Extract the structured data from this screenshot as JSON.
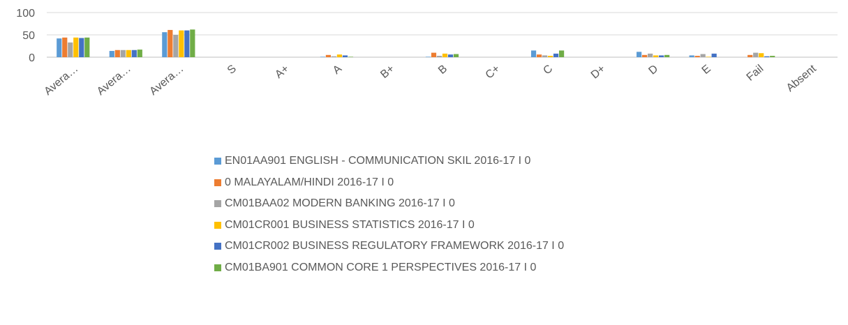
{
  "chart_data": {
    "type": "bar",
    "categories": [
      "Avera…",
      "Avera…",
      "Avera…",
      "S",
      "A+",
      "A",
      "B+",
      "B",
      "C+",
      "C",
      "D+",
      "D",
      "E",
      "Fail",
      "Absent"
    ],
    "ylim": [
      0,
      100
    ],
    "yticks": [
      0,
      50,
      100
    ],
    "grid": true,
    "legend_position": "bottom",
    "series": [
      {
        "name": "EN01AA901 ENGLISH - COMMUNICATION SKIL 2016-17 I 0",
        "color": "#5B9BD5",
        "values": [
          42,
          14,
          56,
          0,
          0,
          1,
          0,
          1,
          0,
          15,
          0,
          12,
          4,
          0,
          0
        ]
      },
      {
        "name": "0 MALAYALAM/HINDI 2016-17 I 0",
        "color": "#ED7D31",
        "values": [
          44,
          16,
          61,
          0,
          0,
          5,
          0,
          10,
          0,
          6,
          0,
          5,
          3,
          5,
          0
        ]
      },
      {
        "name": "CM01BAA02 MODERN BANKING 2016-17 I 0",
        "color": "#A5A5A5",
        "values": [
          33,
          16,
          50,
          0,
          0,
          2,
          0,
          3,
          0,
          4,
          0,
          8,
          7,
          10,
          0
        ]
      },
      {
        "name": "CM01CR001 BUSINESS STATISTICS 2016-17 I 0",
        "color": "#FFC000",
        "values": [
          44,
          16,
          60,
          0,
          0,
          6,
          0,
          8,
          0,
          3,
          0,
          4,
          1,
          9,
          0
        ]
      },
      {
        "name": "CM01CR002 BUSINESS REGULATORY FRAMEWORK 2016-17 I 0",
        "color": "#4472C4",
        "values": [
          43,
          16,
          60,
          0,
          0,
          4,
          0,
          6,
          0,
          8,
          0,
          4,
          8,
          2,
          0
        ]
      },
      {
        "name": "CM01BA901 COMMON CORE 1 PERSPECTIVES 2016-17 I 0",
        "color": "#70AD47",
        "values": [
          44,
          17,
          62,
          0,
          0,
          1,
          0,
          7,
          0,
          15,
          0,
          5,
          0,
          3,
          0
        ]
      }
    ]
  }
}
